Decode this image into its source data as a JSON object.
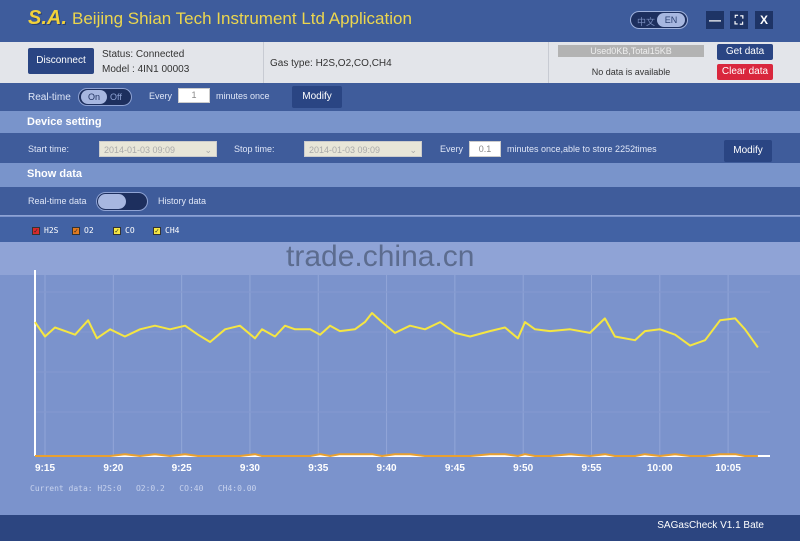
{
  "titlebar": {
    "logo": "S.A.",
    "title": "Beijing Shian Tech Instrument Ltd Application",
    "lang_zh": "中文",
    "lang_en": "EN",
    "minimize": "—",
    "maximize": "⛶",
    "close": "X"
  },
  "info": {
    "disconnect": "Disconnect",
    "status": "Status: Connected",
    "model": "Model : 4IN1 00003",
    "gas_type": "Gas type: H2S,O2,CO,CH4",
    "storage": "Used0KB,Total15KB",
    "no_data": "No data is available",
    "get_data": "Get data",
    "clear_data": "Clear data"
  },
  "realtime": {
    "label": "Real-time",
    "on": "On",
    "off": "Off",
    "every": "Every",
    "interval": "1",
    "unit": "minutes once",
    "modify": "Modify"
  },
  "device": {
    "header": "Device setting",
    "start_label": "Start time:",
    "start_value": "2014-01-03 09:09",
    "stop_label": "Stop time:",
    "stop_value": "2014-01-03 09:09",
    "every": "Every",
    "interval": "0.1",
    "note": "minutes once,able to store  2252times",
    "modify": "Modify"
  },
  "show": {
    "header": "Show data",
    "realtime_label": "Real-time data",
    "history_label": "History data",
    "mode": "Real-time data"
  },
  "legend": [
    {
      "name": "H2S",
      "color": "#d62a2a",
      "checked": true
    },
    {
      "name": "O2",
      "color": "#e07a20",
      "checked": true
    },
    {
      "name": "CO",
      "color": "#f5e642",
      "checked": true
    },
    {
      "name": "CH4",
      "color": "#f5e642",
      "checked": true
    }
  ],
  "watermark": "trade.china.cn",
  "current": "Current data: H2S:0   O2:0.2   CO:40   CH4:0.00",
  "footer": {
    "version": "SAGasCheck V1.1 Bate"
  },
  "chart_data": {
    "type": "line",
    "xlabel": "",
    "ylabel": "",
    "x_ticks": [
      "9:15",
      "9:20",
      "9:25",
      "9:30",
      "9:35",
      "9:40",
      "9:45",
      "9:50",
      "9:55",
      "10:00",
      "10:05"
    ],
    "xlim": [
      "9:14:16",
      "10:08:04"
    ],
    "ylim": [
      0,
      100
    ],
    "grid": true,
    "x": [
      "9:14:16",
      "9:15:00",
      "9:15:44",
      "9:16:28",
      "9:17:12",
      "9:18:09",
      "9:18:48",
      "9:19:46",
      "9:20:51",
      "9:21:57",
      "9:23:03",
      "9:24:09",
      "9:25:15",
      "9:26:12",
      "9:27:05",
      "9:28:11",
      "9:29:16",
      "9:30:22",
      "9:30:53",
      "9:31:50",
      "9:32:34",
      "9:33:18",
      "9:34:24",
      "9:35:08",
      "9:35:52",
      "9:36:35",
      "9:37:41",
      "9:38:25",
      "9:38:56",
      "9:39:40",
      "9:40:37",
      "9:41:43",
      "9:42:49",
      "9:43:55",
      "9:45:01",
      "9:46:07",
      "9:47:34",
      "9:48:40",
      "9:49:37",
      "9:50:08",
      "9:50:52",
      "9:51:58",
      "9:53:26",
      "9:54:53",
      "9:55:59",
      "9:56:43",
      "9:58:11",
      "9:58:55",
      "10:00:01",
      "10:01:07",
      "10:02:13",
      "10:03:19",
      "10:04:25",
      "10:05:31",
      "10:06:14",
      "10:07:11"
    ],
    "series": [
      {
        "name": "CO",
        "color": "#f5e642",
        "values": [
          74,
          66,
          71,
          69,
          67,
          75,
          65,
          70,
          66,
          70,
          72,
          70,
          72,
          67,
          63,
          70,
          72,
          65,
          70,
          66,
          72,
          70,
          70,
          67,
          72,
          69,
          70,
          74,
          79,
          74,
          68,
          72,
          70,
          74,
          68,
          66,
          69,
          71,
          65,
          74,
          70,
          69,
          70,
          68,
          76,
          66,
          64,
          69,
          70,
          67,
          61,
          64,
          75,
          76,
          70,
          60
        ]
      },
      {
        "name": "O2",
        "color": "#e8a030",
        "values": [
          0,
          0,
          0,
          0,
          0,
          0,
          0,
          0,
          1,
          0,
          1,
          0,
          1,
          0,
          0,
          0,
          0,
          1,
          0,
          0,
          0,
          0,
          0,
          1,
          0,
          1,
          1,
          1,
          1,
          0,
          1,
          1,
          0,
          0,
          0,
          0,
          1,
          1,
          0,
          1,
          0,
          0,
          1,
          0,
          1,
          0,
          0,
          1,
          0,
          1,
          0,
          0,
          1,
          1,
          0,
          0
        ]
      }
    ]
  }
}
